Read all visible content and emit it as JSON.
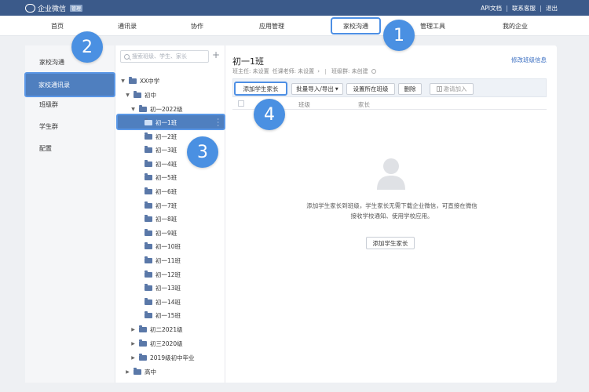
{
  "colors": {
    "topbar": "#3b5a8a",
    "accent": "#4a90e2",
    "highlight_border": "#4d8fe4",
    "selected_bg": "#4f7fbf"
  },
  "brand": {
    "name": "企业微信",
    "badge": "管理"
  },
  "top_links": [
    "API文档",
    "联系客服",
    "退出"
  ],
  "nav": {
    "items": [
      "首页",
      "通讯录",
      "协作",
      "应用管理",
      "家校沟通",
      "管理工具",
      "我的企业"
    ],
    "active": "家校沟通"
  },
  "sidebar": {
    "items": [
      "家校沟通",
      "家校通讯录",
      "班级群",
      "学生群",
      "配置"
    ],
    "active": "家校通讯录"
  },
  "tree": {
    "search_placeholder": "搜索班级、学生、家长",
    "root": "XX中学",
    "level1_open": "初中",
    "grade_open": "初一2022级",
    "classes": [
      "初一1班",
      "初一2班",
      "初一3班",
      "初一4班",
      "初一5班",
      "初一6班",
      "初一7班",
      "初一8班",
      "初一9班",
      "初一10班",
      "初一11班",
      "初一12班",
      "初一13班",
      "初一14班",
      "初一15班"
    ],
    "selected": "初一1班",
    "other_grades": [
      "初二2021级",
      "初三2020级",
      "2019级初中毕业"
    ],
    "level1_closed": "高中"
  },
  "main": {
    "title": "初一1班",
    "edit_link": "修改班级信息",
    "head_teacher": "班主任: 未设置",
    "teachers": "任课老师: 未设置",
    "class_group": "班级群: 未创建",
    "toolbar": {
      "add": "添加学生家长",
      "import": "批量导入/导出",
      "set_class": "设置所在班级",
      "delete": "删除",
      "invite": "邀请加入"
    },
    "columns": [
      "班级",
      "家长"
    ],
    "empty_text": "添加学生家长到班级，学生家长无需下载企业微信，可直接在微信接收学校通知、使用学校应用。",
    "empty_button": "添加学生家长"
  },
  "step_badges": [
    "1",
    "2",
    "3",
    "4"
  ]
}
